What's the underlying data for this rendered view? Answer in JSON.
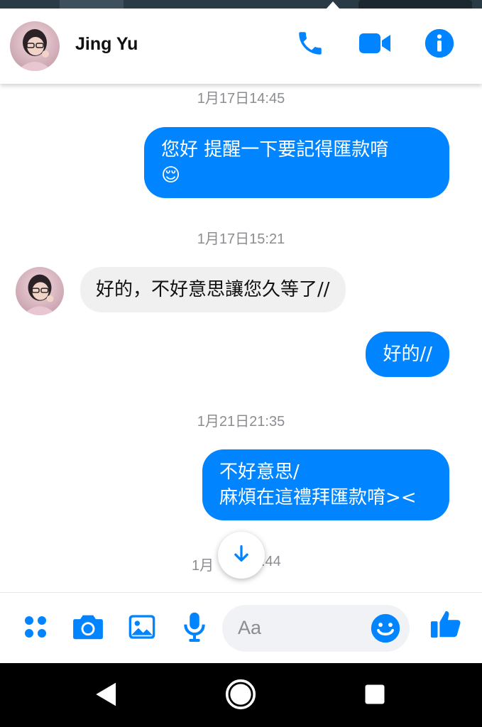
{
  "header": {
    "contact_name": "Jing Yu",
    "icons": [
      "phone-icon",
      "video-camera-icon",
      "info-icon"
    ]
  },
  "messages": [
    {
      "type": "timestamp",
      "text": "1月17日14:45"
    },
    {
      "type": "outgoing",
      "lines": [
        "您好 提醒一下要記得匯款唷",
        "😌"
      ]
    },
    {
      "type": "timestamp",
      "text": "1月17日15:21"
    },
    {
      "type": "incoming",
      "text": "好的，不好意思讓您久等了//"
    },
    {
      "type": "outgoing",
      "lines": [
        "好的//"
      ]
    },
    {
      "type": "timestamp",
      "text": "1月21日21:35"
    },
    {
      "type": "outgoing",
      "lines": [
        "不好意思/",
        "麻煩在這禮拜匯款唷><"
      ]
    },
    {
      "type": "timestamp",
      "text_left": "1月",
      "text_right": ":44"
    }
  ],
  "composer": {
    "placeholder": "Aa",
    "icons": [
      "apps-grid-icon",
      "camera-icon",
      "image-icon",
      "microphone-icon",
      "emoji-icon",
      "thumbs-up-icon"
    ]
  },
  "colors": {
    "accent": "#0084ff",
    "incoming_bubble": "#f0f0f0",
    "timestamp": "#8a8d91"
  }
}
